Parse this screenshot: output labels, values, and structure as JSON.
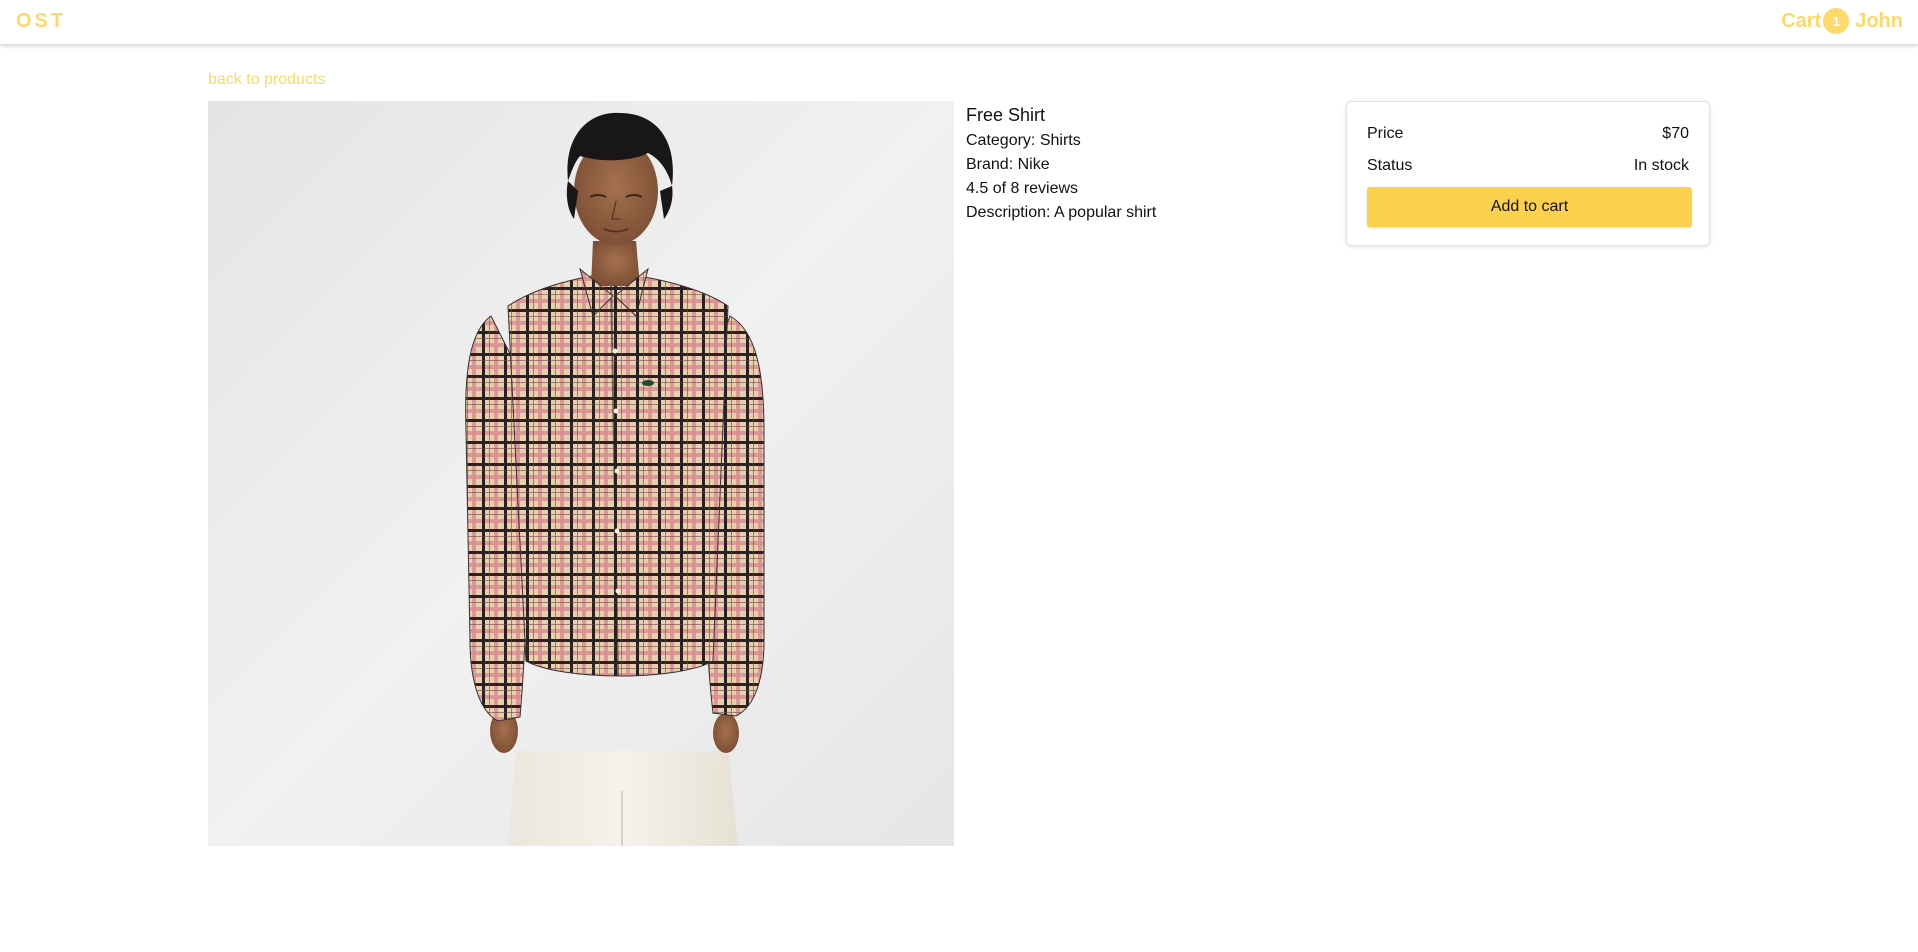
{
  "header": {
    "brand": "OST",
    "cart_label": "Cart",
    "cart_count": "1",
    "user_name": "John",
    "accent_color": "#fdd86b"
  },
  "back_link": "back to products",
  "product": {
    "name": "Free Shirt",
    "category": "Category: Shirts",
    "brand": "Brand: Nike",
    "rating": "4.5 of 8 reviews",
    "description": "Description: A popular shirt",
    "image_alt": "Free Shirt"
  },
  "purchase_card": {
    "price_label": "Price",
    "price_value": "$70",
    "status_label": "Status",
    "status_value": "In stock",
    "add_button": "Add to cart",
    "button_color": "#fcd14e"
  }
}
